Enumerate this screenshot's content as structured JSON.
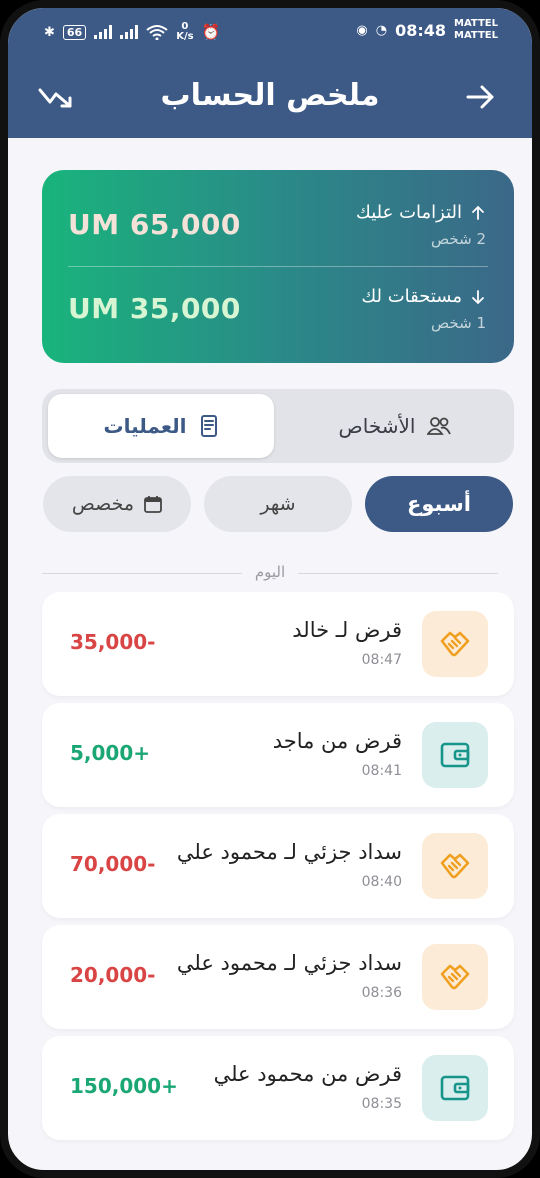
{
  "status": {
    "left_badge": "66",
    "net_speed_value": "0",
    "net_speed_unit": "K/s",
    "time": "08:48",
    "carrier_1": "MATTEL",
    "carrier_2": "MATTEL"
  },
  "header": {
    "title": "ملخص الحساب",
    "back_icon": "arrow-right-icon",
    "trend_icon": "trend-down-icon"
  },
  "summary": {
    "obligations_label": "التزامات عليك",
    "obligations_count": "2 شخص",
    "obligations_amount": "UM 65,000",
    "receivables_label": "مستحقات لك",
    "receivables_count": "1 شخص",
    "receivables_amount": "UM 35,000"
  },
  "segment": {
    "people_label": "الأشخاص",
    "operations_label": "العمليات",
    "selected": "operations"
  },
  "period_chips": {
    "week": "أسبوع",
    "month": "شهر",
    "custom": "مخصص",
    "selected": "week"
  },
  "section_label": "اليوم",
  "transactions": [
    {
      "title": "قرض لـ خالد",
      "time": "08:47",
      "amount": "-35,000",
      "kind": "loan-out"
    },
    {
      "title": "قرض من ماجد",
      "time": "08:41",
      "amount": "+5,000",
      "kind": "loan-in"
    },
    {
      "title": "سداد جزئي لـ محمود علي",
      "time": "08:40",
      "amount": "-70,000",
      "kind": "loan-out"
    },
    {
      "title": "سداد جزئي لـ محمود علي",
      "time": "08:36",
      "amount": "-20,000",
      "kind": "loan-out"
    },
    {
      "title": "قرض من محمود علي",
      "time": "08:35",
      "amount": "+150,000",
      "kind": "loan-in"
    }
  ],
  "colors": {
    "primary": "#3d5a87",
    "negative": "#d94444",
    "positive": "#1aa774",
    "gradient_start": "#19b47c",
    "gradient_end": "#3b6888"
  }
}
